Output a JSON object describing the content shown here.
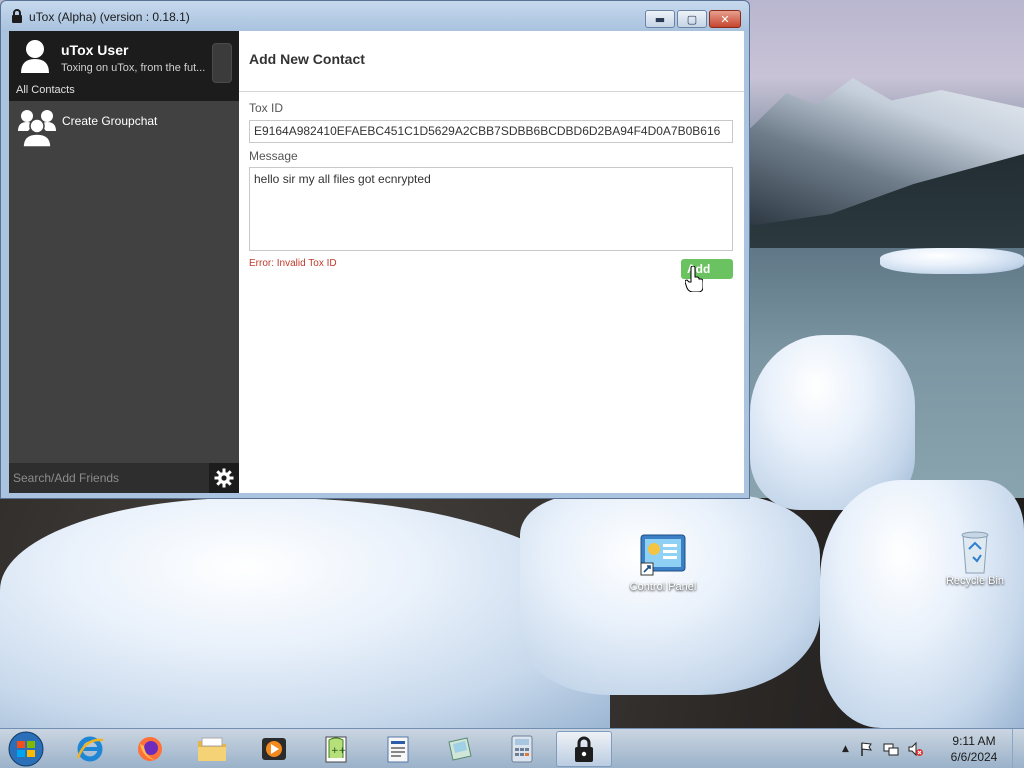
{
  "window": {
    "title": "uTox (Alpha) (version : 0.18.1)",
    "buttons": {
      "minimize": "▬",
      "maximize": "▢",
      "close": "✕"
    }
  },
  "sidebar": {
    "self_name": "uTox User",
    "self_status": "Toxing on uTox, from the fut...",
    "filter_label": "All Contacts",
    "groupchat_label": "Create Groupchat",
    "search_placeholder": "Search/Add Friends"
  },
  "main": {
    "header": "Add New Contact",
    "toxid_label": "Tox ID",
    "toxid_value": "E9164A982410EFAEBC451C1D5629A2CBB7SDBB6BCDBD6D2BA94F4D0A7B0B616",
    "message_label": "Message",
    "message_value": "hello sir my all files got ecnrypted",
    "error_text": "Error: Invalid Tox ID",
    "add_button": "Add"
  },
  "desktop": {
    "icons": [
      {
        "label": "Control Panel",
        "icon": "control-panel-icon"
      },
      {
        "label": "Recycle Bin",
        "icon": "recycle-bin-icon"
      }
    ]
  },
  "taskbar": {
    "items": [
      "internet-explorer-icon",
      "firefox-icon",
      "file-explorer-icon",
      "media-player-icon",
      "notepad-plus-icon",
      "wordpad-icon",
      "sticky-notes-icon",
      "calculator-icon",
      "utox-icon"
    ],
    "time": "9:11 AM",
    "date": "6/6/2024"
  },
  "colors": {
    "add_button": "#6bc260",
    "error_text": "#c0392b",
    "sidebar_bg": "#414141",
    "self_bg": "#1c1c1c"
  }
}
